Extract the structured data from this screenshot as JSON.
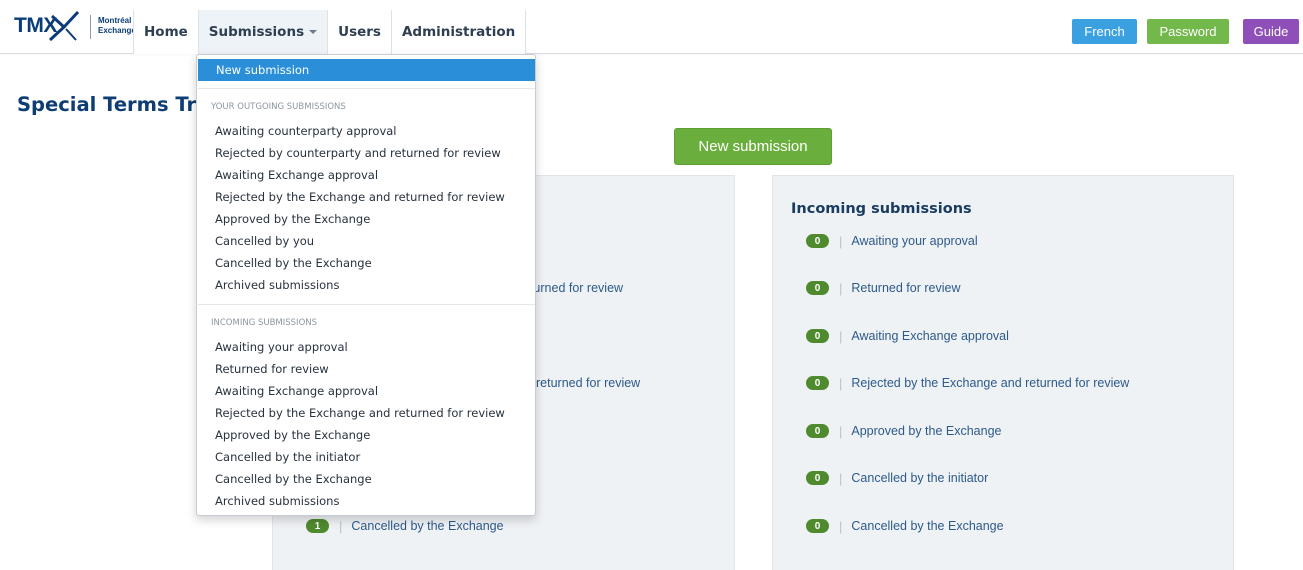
{
  "logo": {
    "brand": "TMX",
    "exchange_line1": "Montréal",
    "exchange_line2": "Exchange"
  },
  "nav": {
    "home": "Home",
    "submissions": "Submissions",
    "users": "Users",
    "administration": "Administration"
  },
  "top_buttons": {
    "french": "French",
    "password": "Password",
    "guide": "Guide"
  },
  "colors": {
    "french": "#3aa0e0",
    "password": "#72b84a",
    "guide": "#8e4fb9",
    "new_submission": "#6aaf3d",
    "badge": "#4f8a2e",
    "highlight": "#2a8fd8"
  },
  "page_title": "Special Terms Tr",
  "new_submission_button": "New submission",
  "dropdown": {
    "new_submission": "New submission",
    "outgoing_header": "YOUR OUTGOING SUBMISSIONS",
    "outgoing_items": [
      "Awaiting counterparty approval",
      "Rejected by counterparty and returned for review",
      "Awaiting Exchange approval",
      "Rejected by the Exchange and returned for review",
      "Approved by the Exchange",
      "Cancelled by you",
      "Cancelled by the Exchange",
      "Archived submissions"
    ],
    "incoming_header": "INCOMING SUBMISSIONS",
    "incoming_items": [
      "Awaiting your approval",
      "Returned for review",
      "Awaiting Exchange approval",
      "Rejected by the Exchange and returned for review",
      "Approved by the Exchange",
      "Cancelled by the initiator",
      "Cancelled by the Exchange",
      "Archived submissions"
    ]
  },
  "left_panel": {
    "visible_fragments": [
      "eturned for review",
      "returned for review"
    ],
    "last_row": {
      "count": "1",
      "label": "Cancelled by the Exchange"
    }
  },
  "right_panel": {
    "heading": "Incoming submissions",
    "rows": [
      {
        "count": "0",
        "label": "Awaiting your approval"
      },
      {
        "count": "0",
        "label": "Returned for review"
      },
      {
        "count": "0",
        "label": "Awaiting Exchange approval"
      },
      {
        "count": "0",
        "label": "Rejected by the Exchange and returned for review"
      },
      {
        "count": "0",
        "label": "Approved by the Exchange"
      },
      {
        "count": "0",
        "label": "Cancelled by the initiator"
      },
      {
        "count": "0",
        "label": "Cancelled by the Exchange"
      }
    ]
  }
}
